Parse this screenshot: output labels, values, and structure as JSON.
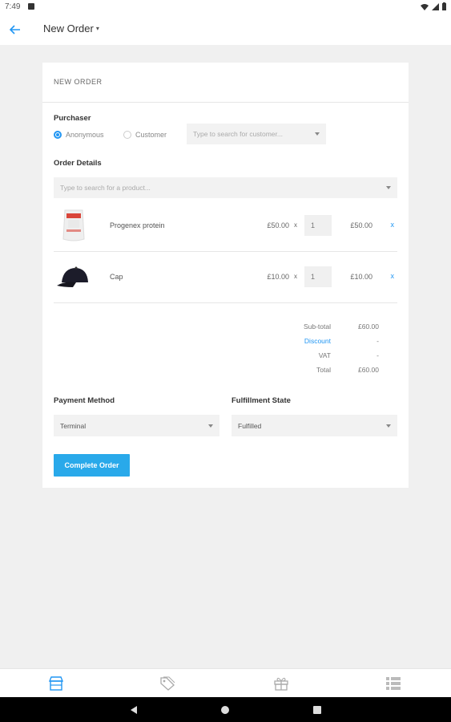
{
  "status_bar": {
    "time": "7:49"
  },
  "app_bar": {
    "title": "New Order",
    "caret": "▾"
  },
  "card": {
    "title": "NEW ORDER",
    "purchaser": {
      "label": "Purchaser",
      "options": [
        {
          "label": "Anonymous",
          "checked": true
        },
        {
          "label": "Customer",
          "checked": false
        }
      ],
      "customer_search_placeholder": "Type to search for customer..."
    },
    "order_details": {
      "label": "Order Details",
      "product_search_placeholder": "Type to search for a product...",
      "items": [
        {
          "name": "Progenex protein",
          "price": "£50.00",
          "times": "x",
          "quantity": "1",
          "total": "£50.00",
          "remove": "x",
          "image": "protein-bag-image"
        },
        {
          "name": "Cap",
          "price": "£10.00",
          "times": "x",
          "quantity": "1",
          "total": "£10.00",
          "remove": "x",
          "image": "cap-image"
        }
      ]
    },
    "totals": {
      "subtotal_label": "Sub-total",
      "subtotal_value": "£60.00",
      "discount_label": "Discount",
      "discount_value": "-",
      "vat_label": "VAT",
      "vat_value": "-",
      "total_label": "Total",
      "total_value": "£60.00"
    },
    "payment": {
      "label": "Payment Method",
      "value": "Terminal"
    },
    "fulfillment": {
      "label": "Fulfillment State",
      "value": "Fulfilled"
    },
    "complete_button": "Complete Order"
  },
  "bottom_nav": {
    "items": [
      "store-icon",
      "tag-icon",
      "gift-icon",
      "list-icon"
    ],
    "active": "store-icon",
    "accent": "#2196f3"
  }
}
